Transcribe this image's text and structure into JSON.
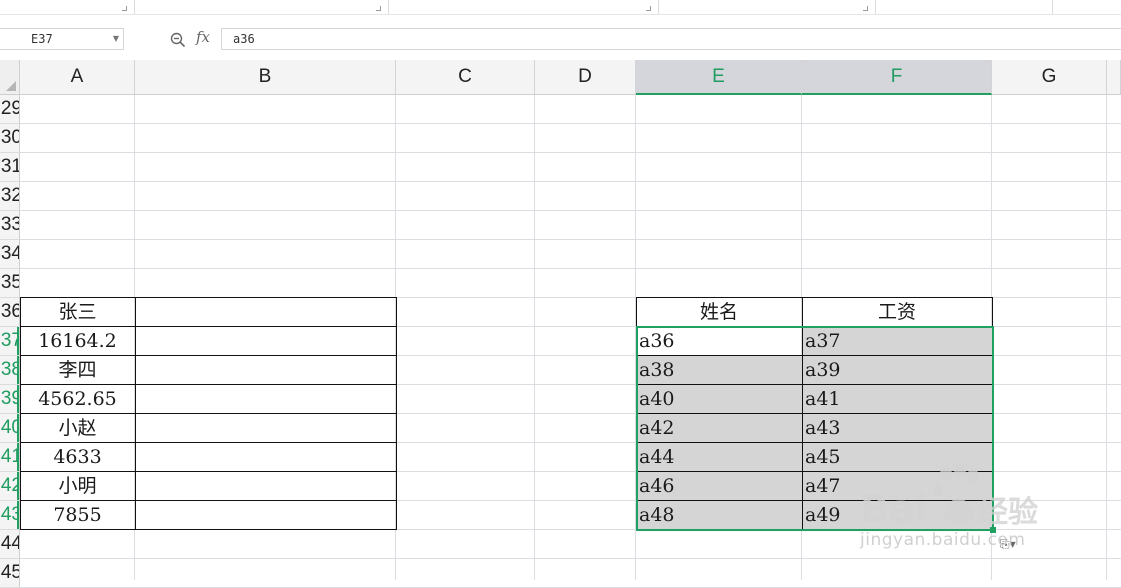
{
  "formula_bar": {
    "cell_ref": "E37",
    "fx_label": "fx",
    "formula": "a36"
  },
  "columns": [
    {
      "label": "A",
      "selected": false
    },
    {
      "label": "B",
      "selected": false
    },
    {
      "label": "C",
      "selected": false
    },
    {
      "label": "D",
      "selected": false
    },
    {
      "label": "E",
      "selected": true
    },
    {
      "label": "F",
      "selected": true
    },
    {
      "label": "G",
      "selected": false
    }
  ],
  "rows": [
    {
      "label": "29",
      "selected": false
    },
    {
      "label": "30",
      "selected": false
    },
    {
      "label": "31",
      "selected": false
    },
    {
      "label": "32",
      "selected": false
    },
    {
      "label": "33",
      "selected": false
    },
    {
      "label": "34",
      "selected": false
    },
    {
      "label": "35",
      "selected": false
    },
    {
      "label": "36",
      "selected": false
    },
    {
      "label": "37",
      "selected": true
    },
    {
      "label": "38",
      "selected": true
    },
    {
      "label": "39",
      "selected": true
    },
    {
      "label": "40",
      "selected": true
    },
    {
      "label": "41",
      "selected": true
    },
    {
      "label": "42",
      "selected": true
    },
    {
      "label": "43",
      "selected": true
    },
    {
      "label": "44",
      "selected": false
    },
    {
      "label": "45",
      "selected": false
    }
  ],
  "left_table": {
    "cells": [
      "张三",
      "16164.2",
      "李四",
      "4562.65",
      "小赵",
      "4633",
      "小明",
      "7855"
    ]
  },
  "right_table": {
    "headers": [
      "姓名",
      "工资"
    ],
    "rows": [
      [
        "a36",
        "a37"
      ],
      [
        "a38",
        "a39"
      ],
      [
        "a40",
        "a41"
      ],
      [
        "a42",
        "a43"
      ],
      [
        "a44",
        "a45"
      ],
      [
        "a46",
        "a47"
      ],
      [
        "a48",
        "a49"
      ]
    ]
  },
  "watermark": {
    "text": "jingyan.baidu.com"
  },
  "colors": {
    "selection": "#20a162",
    "selected_header_bg": "#d4d6db",
    "selected_cell_fill": "#d5d5d5"
  }
}
